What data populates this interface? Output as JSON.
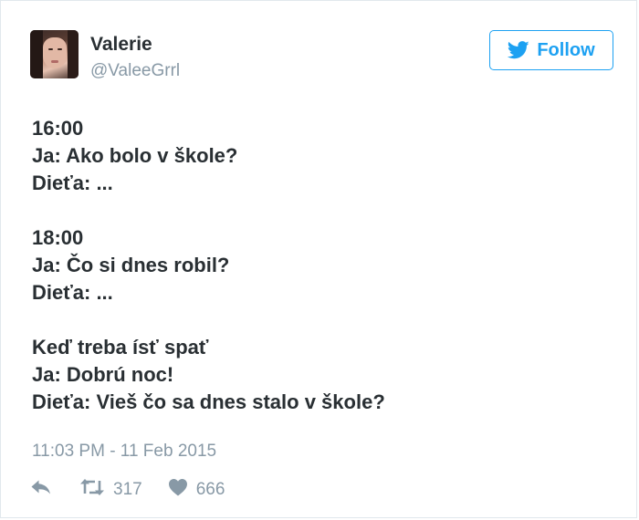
{
  "user": {
    "name": "Valerie",
    "handle": "@ValeeGrrl"
  },
  "follow_button": {
    "label": "Follow",
    "icon": "twitter-bird-icon",
    "color": "#1da1f2"
  },
  "tweet": {
    "lines": [
      "16:00",
      "Ja: Ako bolo v škole?",
      "Dieťa: ...",
      "",
      "18:00",
      "Ja: Čo si dnes robil?",
      "Dieťa: ...",
      "",
      "Keď treba ísť spať",
      "Ja: Dobrú noc!",
      "Dieťa: Vieš čo sa dnes stalo v škole?"
    ],
    "timestamp": "11:03 PM - 11 Feb 2015"
  },
  "actions": {
    "reply": {
      "icon": "reply-icon"
    },
    "retweet": {
      "icon": "retweet-icon",
      "count": "317"
    },
    "like": {
      "icon": "heart-icon",
      "count": "666"
    }
  }
}
